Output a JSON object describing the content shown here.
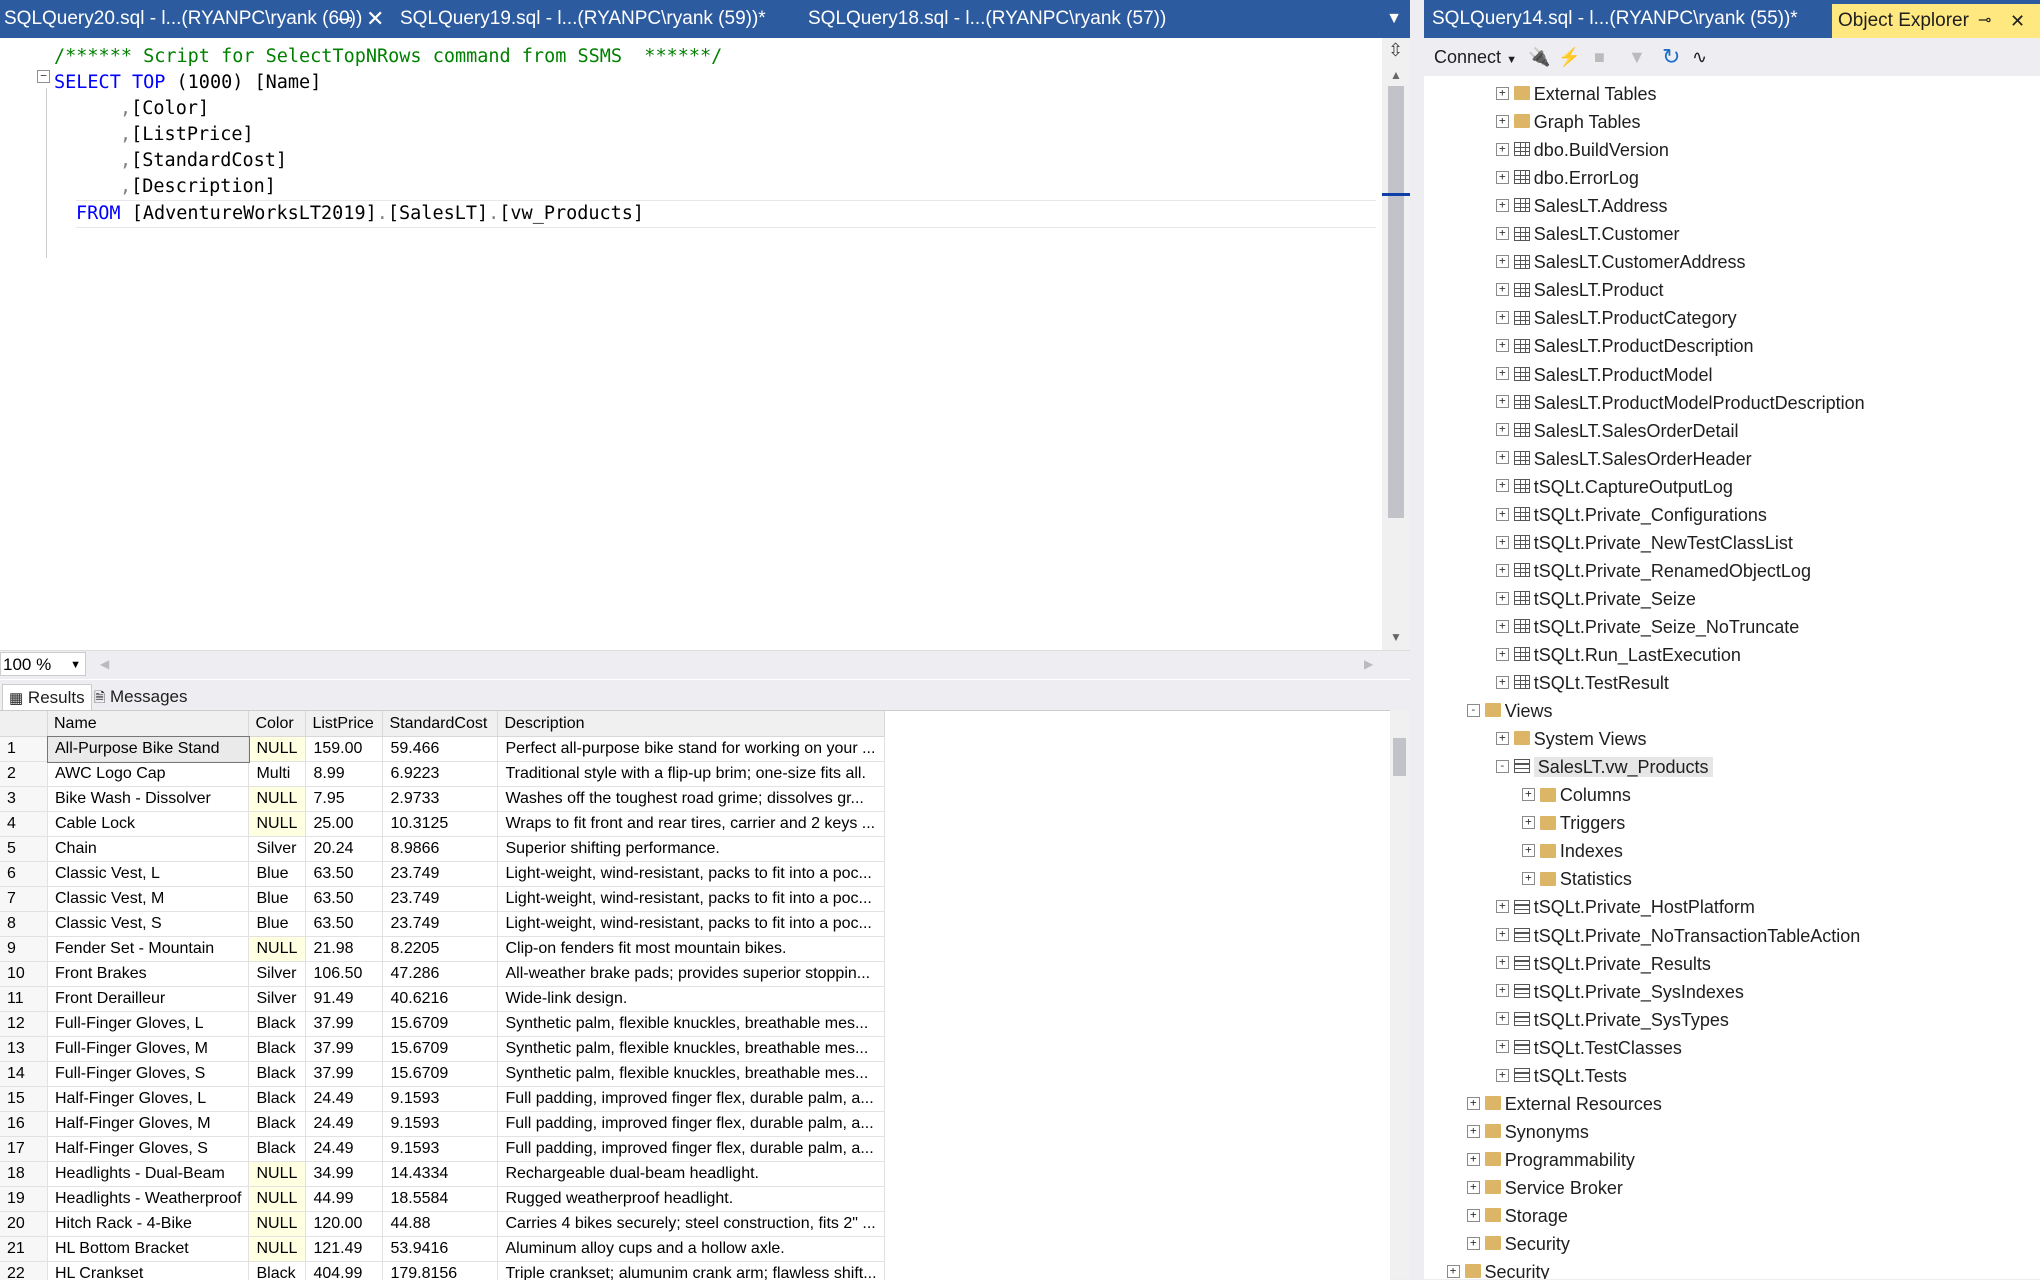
{
  "editor": {
    "tabs": [
      {
        "label": "SQLQuery20.sql - l...(RYANPC\\ryank (60))",
        "active": true
      },
      {
        "label": "SQLQuery19.sql - l...(RYANPC\\ryank (59))*",
        "active": false
      },
      {
        "label": "SQLQuery18.sql - l...(RYANPC\\ryank (57))",
        "active": false
      }
    ],
    "pin_icon": "pin-icon",
    "close_icon": "close-icon",
    "code": {
      "comment": "/****** Script for SelectTopNRows command from SSMS  ******/",
      "select_kw": "SELECT",
      "top_kw": "TOP",
      "top_value": "(1000)",
      "col1": "[Name]",
      "col2": "[Color]",
      "col3": "[ListPrice]",
      "col4": "[StandardCost]",
      "col5": "[Description]",
      "from_kw": "FROM",
      "db": "[AdventureWorksLT2019]",
      "schema": "[SalesLT]",
      "object": "[vw_Products]",
      "dot": ".",
      "comma": ","
    },
    "zoom": "100 %"
  },
  "results": {
    "tabs": [
      {
        "label": "Results",
        "icon": "grid-icon"
      },
      {
        "label": "Messages",
        "icon": "messages-icon"
      }
    ],
    "columns": [
      "Name",
      "Color",
      "ListPrice",
      "StandardCost",
      "Description"
    ],
    "rows": [
      [
        "1",
        "All-Purpose Bike Stand",
        "NULL",
        "159.00",
        "59.466",
        "Perfect all-purpose bike stand for working on your ..."
      ],
      [
        "2",
        "AWC Logo Cap",
        "Multi",
        "8.99",
        "6.9223",
        "Traditional style with a flip-up brim; one-size fits all."
      ],
      [
        "3",
        "Bike Wash - Dissolver",
        "NULL",
        "7.95",
        "2.9733",
        "Washes off the toughest road grime; dissolves gr..."
      ],
      [
        "4",
        "Cable Lock",
        "NULL",
        "25.00",
        "10.3125",
        "Wraps to fit front and rear tires, carrier and 2 keys ..."
      ],
      [
        "5",
        "Chain",
        "Silver",
        "20.24",
        "8.9866",
        "Superior shifting performance."
      ],
      [
        "6",
        "Classic Vest, L",
        "Blue",
        "63.50",
        "23.749",
        "Light-weight, wind-resistant, packs to fit into a poc..."
      ],
      [
        "7",
        "Classic Vest, M",
        "Blue",
        "63.50",
        "23.749",
        "Light-weight, wind-resistant, packs to fit into a poc..."
      ],
      [
        "8",
        "Classic Vest, S",
        "Blue",
        "63.50",
        "23.749",
        "Light-weight, wind-resistant, packs to fit into a poc..."
      ],
      [
        "9",
        "Fender Set - Mountain",
        "NULL",
        "21.98",
        "8.2205",
        "Clip-on fenders fit most mountain bikes."
      ],
      [
        "10",
        "Front Brakes",
        "Silver",
        "106.50",
        "47.286",
        "All-weather brake pads; provides superior stoppin..."
      ],
      [
        "11",
        "Front Derailleur",
        "Silver",
        "91.49",
        "40.6216",
        "Wide-link design."
      ],
      [
        "12",
        "Full-Finger Gloves, L",
        "Black",
        "37.99",
        "15.6709",
        "Synthetic palm, flexible knuckles, breathable mes..."
      ],
      [
        "13",
        "Full-Finger Gloves, M",
        "Black",
        "37.99",
        "15.6709",
        "Synthetic palm, flexible knuckles, breathable mes..."
      ],
      [
        "14",
        "Full-Finger Gloves, S",
        "Black",
        "37.99",
        "15.6709",
        "Synthetic palm, flexible knuckles, breathable mes..."
      ],
      [
        "15",
        "Half-Finger Gloves, L",
        "Black",
        "24.49",
        "9.1593",
        "Full padding, improved finger flex, durable palm, a..."
      ],
      [
        "16",
        "Half-Finger Gloves, M",
        "Black",
        "24.49",
        "9.1593",
        "Full padding, improved finger flex, durable palm, a..."
      ],
      [
        "17",
        "Half-Finger Gloves, S",
        "Black",
        "24.49",
        "9.1593",
        "Full padding, improved finger flex, durable palm, a..."
      ],
      [
        "18",
        "Headlights - Dual-Beam",
        "NULL",
        "34.99",
        "14.4334",
        "Rechargeable dual-beam headlight."
      ],
      [
        "19",
        "Headlights - Weatherproof",
        "NULL",
        "44.99",
        "18.5584",
        "Rugged weatherproof headlight."
      ],
      [
        "20",
        "Hitch Rack - 4-Bike",
        "NULL",
        "120.00",
        "44.88",
        "Carries 4 bikes securely; steel construction, fits 2\" ..."
      ],
      [
        "21",
        "HL Bottom Bracket",
        "NULL",
        "121.49",
        "53.9416",
        "Aluminum alloy cups and a hollow axle."
      ],
      [
        "22",
        "HL Crankset",
        "Black",
        "404.99",
        "179.8156",
        "Triple crankset; alumunim crank arm; flawless shift..."
      ]
    ]
  },
  "object_explorer": {
    "tab_label": "SQLQuery14.sql - l...(RYANPC\\ryank (55))*",
    "title": "Object Explorer",
    "toolbar": {
      "connect_label": "Connect",
      "icons": [
        "connect-plug-icon",
        "disconnect-icon",
        "stop-icon",
        "filter-icon",
        "refresh-icon",
        "activity-monitor-icon"
      ]
    },
    "tree": [
      {
        "label": "External Tables",
        "icon": "folder",
        "level": 2,
        "state": "+"
      },
      {
        "label": "Graph Tables",
        "icon": "folder",
        "level": 2,
        "state": "+"
      },
      {
        "label": "dbo.BuildVersion",
        "icon": "table",
        "level": 2,
        "state": "+"
      },
      {
        "label": "dbo.ErrorLog",
        "icon": "table",
        "level": 2,
        "state": "+"
      },
      {
        "label": "SalesLT.Address",
        "icon": "table",
        "level": 2,
        "state": "+"
      },
      {
        "label": "SalesLT.Customer",
        "icon": "table",
        "level": 2,
        "state": "+"
      },
      {
        "label": "SalesLT.CustomerAddress",
        "icon": "table",
        "level": 2,
        "state": "+"
      },
      {
        "label": "SalesLT.Product",
        "icon": "table",
        "level": 2,
        "state": "+"
      },
      {
        "label": "SalesLT.ProductCategory",
        "icon": "table",
        "level": 2,
        "state": "+"
      },
      {
        "label": "SalesLT.ProductDescription",
        "icon": "table",
        "level": 2,
        "state": "+"
      },
      {
        "label": "SalesLT.ProductModel",
        "icon": "table",
        "level": 2,
        "state": "+"
      },
      {
        "label": "SalesLT.ProductModelProductDescription",
        "icon": "table",
        "level": 2,
        "state": "+"
      },
      {
        "label": "SalesLT.SalesOrderDetail",
        "icon": "table",
        "level": 2,
        "state": "+"
      },
      {
        "label": "SalesLT.SalesOrderHeader",
        "icon": "table",
        "level": 2,
        "state": "+"
      },
      {
        "label": "tSQLt.CaptureOutputLog",
        "icon": "table",
        "level": 2,
        "state": "+"
      },
      {
        "label": "tSQLt.Private_Configurations",
        "icon": "table",
        "level": 2,
        "state": "+"
      },
      {
        "label": "tSQLt.Private_NewTestClassList",
        "icon": "table",
        "level": 2,
        "state": "+"
      },
      {
        "label": "tSQLt.Private_RenamedObjectLog",
        "icon": "table",
        "level": 2,
        "state": "+"
      },
      {
        "label": "tSQLt.Private_Seize",
        "icon": "table",
        "level": 2,
        "state": "+"
      },
      {
        "label": "tSQLt.Private_Seize_NoTruncate",
        "icon": "table",
        "level": 2,
        "state": "+"
      },
      {
        "label": "tSQLt.Run_LastExecution",
        "icon": "table",
        "level": 2,
        "state": "+"
      },
      {
        "label": "tSQLt.TestResult",
        "icon": "table",
        "level": 2,
        "state": "+"
      },
      {
        "label": "Views",
        "icon": "folder",
        "level": 1,
        "state": "-"
      },
      {
        "label": "System Views",
        "icon": "folder",
        "level": 2,
        "state": "+"
      },
      {
        "label": "SalesLT.vw_Products",
        "icon": "view",
        "level": 2,
        "state": "-",
        "selected": true
      },
      {
        "label": "Columns",
        "icon": "folder",
        "level": 3,
        "state": "+"
      },
      {
        "label": "Triggers",
        "icon": "folder",
        "level": 3,
        "state": "+"
      },
      {
        "label": "Indexes",
        "icon": "folder",
        "level": 3,
        "state": "+"
      },
      {
        "label": "Statistics",
        "icon": "folder",
        "level": 3,
        "state": "+"
      },
      {
        "label": "tSQLt.Private_HostPlatform",
        "icon": "view",
        "level": 2,
        "state": "+"
      },
      {
        "label": "tSQLt.Private_NoTransactionTableAction",
        "icon": "view",
        "level": 2,
        "state": "+"
      },
      {
        "label": "tSQLt.Private_Results",
        "icon": "view",
        "level": 2,
        "state": "+"
      },
      {
        "label": "tSQLt.Private_SysIndexes",
        "icon": "view",
        "level": 2,
        "state": "+"
      },
      {
        "label": "tSQLt.Private_SysTypes",
        "icon": "view",
        "level": 2,
        "state": "+"
      },
      {
        "label": "tSQLt.TestClasses",
        "icon": "view",
        "level": 2,
        "state": "+"
      },
      {
        "label": "tSQLt.Tests",
        "icon": "view",
        "level": 2,
        "state": "+"
      },
      {
        "label": "External Resources",
        "icon": "folder",
        "level": 1,
        "state": "+"
      },
      {
        "label": "Synonyms",
        "icon": "folder",
        "level": 1,
        "state": "+"
      },
      {
        "label": "Programmability",
        "icon": "folder",
        "level": 1,
        "state": "+"
      },
      {
        "label": "Service Broker",
        "icon": "folder",
        "level": 1,
        "state": "+"
      },
      {
        "label": "Storage",
        "icon": "folder",
        "level": 1,
        "state": "+"
      },
      {
        "label": "Security",
        "icon": "folder",
        "level": 1,
        "state": "+"
      },
      {
        "label": "Security",
        "icon": "folder",
        "level": 0,
        "state": "+"
      }
    ]
  },
  "colors": {
    "tab_blue": "#2d5ba0",
    "oe_title_yellow": "#ffe87f",
    "null_cell": "#ffffe1",
    "keyword_blue": "#0000ff",
    "comment_green": "#008000"
  }
}
